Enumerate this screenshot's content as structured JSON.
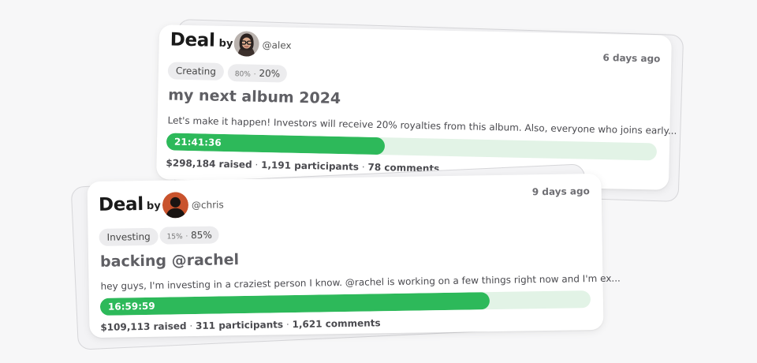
{
  "cards": [
    {
      "deal_label": "Deal",
      "by_label": "by",
      "handle": "@alex",
      "time": "6 days ago",
      "tag": "Creating",
      "pct_small": "80%",
      "pct_sep": "·",
      "pct_main": "20%",
      "title": "my next album 2024",
      "description": "Let's make it happen! Investors will receive 20% royalties from this album. Also, everyone who joins early...",
      "timer": "21:41:36",
      "progress": 0.445,
      "raised": "$298,184 raised",
      "participants": "1,191 participants",
      "comments": "78 comments",
      "avatar_icon": "user-avatar-glasses-icon"
    },
    {
      "deal_label": "Deal",
      "by_label": "by",
      "handle": "@chris",
      "time": "9 days ago",
      "tag": "Investing",
      "pct_small": "15%",
      "pct_sep": "·",
      "pct_main": "85%",
      "title": "backing @rachel",
      "description": "hey guys, I'm investing in a craziest person I know. @rachel is working on a few things right now and I'm ex...",
      "timer": "16:59:59",
      "progress": 0.795,
      "raised": "$109,113 raised",
      "participants": "311 participants",
      "comments": "1,621 comments",
      "avatar_icon": "user-avatar-silhouette-icon"
    }
  ],
  "stats_separator": "·",
  "colors": {
    "progress_fill": "#2db95a",
    "progress_track": "#e2f3e6",
    "tag_bg": "#ececee"
  }
}
